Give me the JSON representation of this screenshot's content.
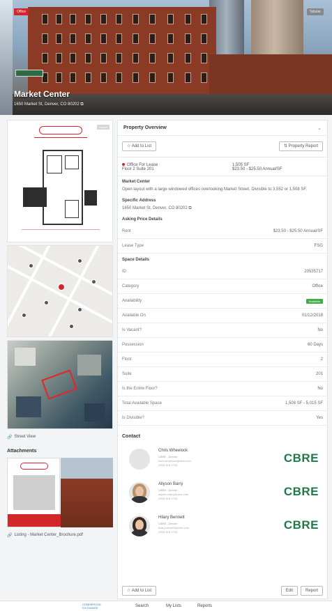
{
  "hero": {
    "badge": "Office",
    "tab": "Tabular",
    "title": "Market Center",
    "address": "1650 Market St, Denver, CO 80202"
  },
  "left": {
    "floorplan_tag": "Closed",
    "street_view": "Street View",
    "attachments_heading": "Attachments",
    "attachment_file": "Listing - Market Center_Brochure.pdf"
  },
  "overview": {
    "title": "Property Overview",
    "add_to_list": "Add to List",
    "property_report": "Property Report",
    "status": "Office For Lease",
    "floor_suite": "Floor 2 Suite 201",
    "size": "1,505 SF",
    "rate": "$23.50 - $25.50 Annual/SF",
    "desc_title": "Market Center",
    "desc": "Open layout with a large windowed offices overlooking Market Street. Divisible to 3,552 or 1,508 SF.",
    "address_title": "Specific Address",
    "address": "1650 Market St, Denver, CO 80202",
    "asking_title": "Asking Price Details",
    "space_title": "Space Details"
  },
  "asking_rows": [
    {
      "k": "Rent",
      "v": "$23.50 - $25.50 Annual/SF"
    },
    {
      "k": "Lease Type",
      "v": "FSG"
    }
  ],
  "space_rows": [
    {
      "k": "ID",
      "v": "20535717"
    },
    {
      "k": "Category",
      "v": "Office"
    },
    {
      "k": "Availability",
      "v": "Available"
    },
    {
      "k": "Available On",
      "v": "01/12/2018"
    },
    {
      "k": "Is Vacant?",
      "v": "No"
    },
    {
      "k": "Possession",
      "v": "60 Days"
    },
    {
      "k": "Floor",
      "v": "2"
    },
    {
      "k": "Suite",
      "v": "201"
    },
    {
      "k": "Is the Entire Floor?",
      "v": "No"
    },
    {
      "k": "Total Available Space",
      "v": "1,508 SF - 5,015 SF"
    },
    {
      "k": "Is Divisible?",
      "v": "Yes"
    }
  ],
  "contact": {
    "title": "Contact",
    "people": [
      {
        "name": "Chris Wheelock",
        "role": "CBRE - Denver",
        "email": "chris.wheelock@cbre.com",
        "phone": "(303) 628-1700",
        "logo": "CBRE"
      },
      {
        "name": "Allyson Barry",
        "role": "CBRE - Denver",
        "email": "allyson.barry@cbre.com",
        "phone": "(303) 628-1700",
        "logo": "CBRE"
      },
      {
        "name": "Hilary Bennett",
        "role": "CBRE - Denver",
        "email": "hilary.bennett@cbre.com",
        "phone": "(303) 628-1700",
        "logo": "CBRE"
      }
    ],
    "add_btn": "Add to List",
    "edit_btn": "Edit",
    "report_btn": "Report"
  },
  "footer": {
    "logo_line1": "COMMERCIAL",
    "logo_line2": "EXCHANGE",
    "nav": [
      "Search",
      "My Lists",
      "Reports"
    ]
  },
  "colors": {
    "accent": "#d3262b",
    "cbre": "#1e7b4a",
    "available": "#3fae49"
  }
}
